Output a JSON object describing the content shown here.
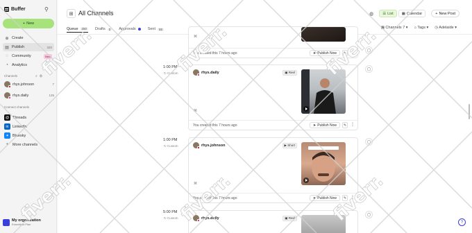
{
  "sidebar": {
    "logo": "Buffer",
    "new_label": "New",
    "nav": [
      {
        "label": "Create",
        "icon": "create-icon"
      },
      {
        "label": "Publish",
        "icon": "publish-icon",
        "count": "320",
        "active": true
      },
      {
        "label": "Community",
        "icon": "community-icon",
        "badge": "New"
      },
      {
        "label": "Analytics",
        "icon": "analytics-icon"
      }
    ],
    "channels_label": "Channels",
    "channels": [
      {
        "name": "rhys.johnson",
        "count": "7"
      },
      {
        "name": "rhys.daily",
        "count": "125"
      }
    ],
    "connect_label": "Connect channels",
    "connect": [
      {
        "name": "Threads",
        "icon": "threads-icon"
      },
      {
        "name": "LinkedIn",
        "icon": "linkedin-icon"
      },
      {
        "name": "Bluesky",
        "icon": "bluesky-icon"
      }
    ],
    "more_channels": "More channels",
    "org": {
      "name": "My organization",
      "plan": "Essentials Plan"
    }
  },
  "header": {
    "title": "All Channels",
    "view_list": "List",
    "view_calendar": "Calendar",
    "new_post": "New Post"
  },
  "tabs": [
    {
      "label": "Queue",
      "count": "250",
      "active": true
    },
    {
      "label": "Drafts",
      "count": "0"
    },
    {
      "label": "Approvals",
      "count": ""
    },
    {
      "label": "Sent",
      "count": "55"
    }
  ],
  "filters": {
    "channels": "Channels",
    "channels_count": "7",
    "tags": "Tags",
    "timezone": "Adelaide"
  },
  "posts": [
    {
      "time": "",
      "custom": "",
      "account": "",
      "type": "",
      "created": "You created this 7 hours ago",
      "publish": "Publish Now"
    },
    {
      "time": "1:00 PM",
      "custom": "Custom",
      "account": "rhys.daily",
      "type": "Reel",
      "created": "You created this 7 hours ago",
      "publish": "Publish Now"
    },
    {
      "time": "1:00 PM",
      "custom": "Custom",
      "account": "rhys.johnson",
      "type": "Short",
      "created": "You created this 7 hours ago",
      "publish": "Publish Now"
    },
    {
      "time": "5:00 PM",
      "custom": "Custom",
      "account": "rhys.daily",
      "type": "Reel",
      "created": "",
      "publish": ""
    }
  ],
  "watermark": "fiverr.",
  "colors": {
    "accent_green": "#a7e27c",
    "brand_blue": "#3b3fd9",
    "instagram_pink": "#ec3d7a",
    "youtube_red": "#e0271f"
  }
}
